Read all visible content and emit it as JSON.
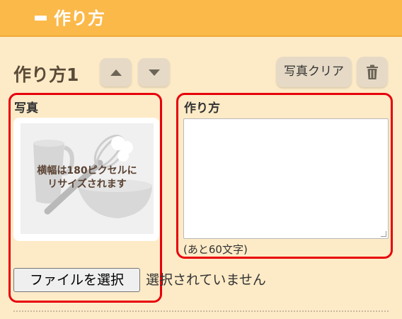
{
  "header": {
    "title": "作り方",
    "collapse_icon": "minus-icon"
  },
  "step": {
    "title": "作り方1",
    "move_up_icon": "triangle-up-icon",
    "move_down_icon": "triangle-down-icon",
    "clear_photo_label": "写真クリア",
    "delete_icon": "trash-icon"
  },
  "photo": {
    "label": "写真",
    "placeholder_line1": "横幅は180ピクセルに",
    "placeholder_line2": "リサイズされます",
    "file_button_label": "ファイルを選択",
    "file_status": "選択されていません"
  },
  "instructions": {
    "label": "作り方",
    "value": "",
    "remaining": "(あと60文字)"
  },
  "colors": {
    "header_bg": "#fbb94a",
    "page_bg": "#fdebc7",
    "highlight": "#e8000b"
  }
}
